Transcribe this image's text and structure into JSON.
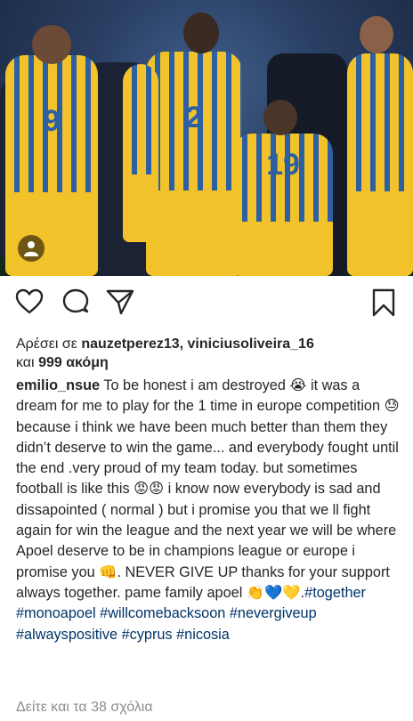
{
  "post": {
    "likes_prefix": "Αρέσει σε ",
    "liker_1": "nauzetperez13",
    "likes_sep": ", ",
    "liker_2": "viniciusoliveira_16",
    "likes_and": "και ",
    "likes_more": "999 ακόμη",
    "caption_user": "emilio_nsue",
    "caption_body": " To be honest i am destroyed 😭 it was a dream for me to play for the 1 time in europe competition 😓 because i think we have been much better than them they didn’t deserve to win the game... and everybody fought until the end .very proud of my team today. but sometimes football is like this 😡😡 i know now everybody is sad and dissapointed ( normal ) but i promise you that we ll fight again for win the league and the next year we will be where Apoel deserve to be in champions league or europe i promise you 👊. NEVER GIVE UP thanks for your support always together. pame family apoel 👏💙💛.",
    "hashtags": [
      "#together",
      "#monoapoel",
      "#willcomebacksoon",
      "#nevergiveup",
      "#alwayspositive",
      "#cyprus",
      "#nicosia"
    ],
    "view_comments": "Δείτε και τα 38 σχόλια"
  },
  "photo": {
    "jersey_numbers": [
      "9",
      "2",
      "19"
    ],
    "colors": {
      "jersey_yellow": "#f2c22b",
      "jersey_blue": "#2d5fa3"
    }
  },
  "icons": [
    "heart-icon",
    "comment-icon",
    "share-icon",
    "bookmark-icon",
    "user-tag-icon"
  ]
}
